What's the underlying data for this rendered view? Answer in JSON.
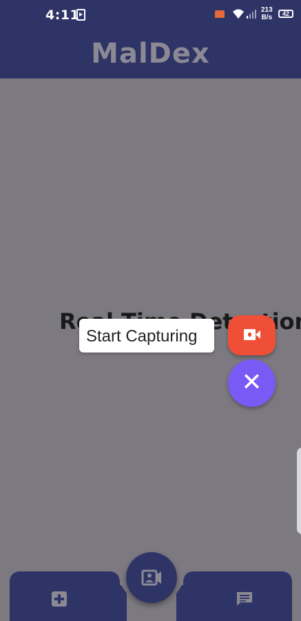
{
  "status_bar": {
    "time": "4:11",
    "net_speed_value": "213",
    "net_speed_unit": "B/s",
    "battery": "42"
  },
  "app_bar": {
    "title": "MalDex"
  },
  "main": {
    "headline": "Real Time Detection"
  },
  "speed_dial": {
    "capture_tooltip": "Start Capturing",
    "capture_icon": "video-camera-icon",
    "close_icon": "close-icon",
    "close_glyph": "✕"
  },
  "bottom_nav": {
    "left_icon": "add-box-icon",
    "center_icon": "video-contact-icon",
    "right_icon": "chat-icon"
  },
  "colors": {
    "primary": "#2f3466",
    "scrim": "#7c7a80",
    "capture_fab": "#f04f37",
    "close_fab": "#7a5af5",
    "title_text": "#8a8994"
  }
}
